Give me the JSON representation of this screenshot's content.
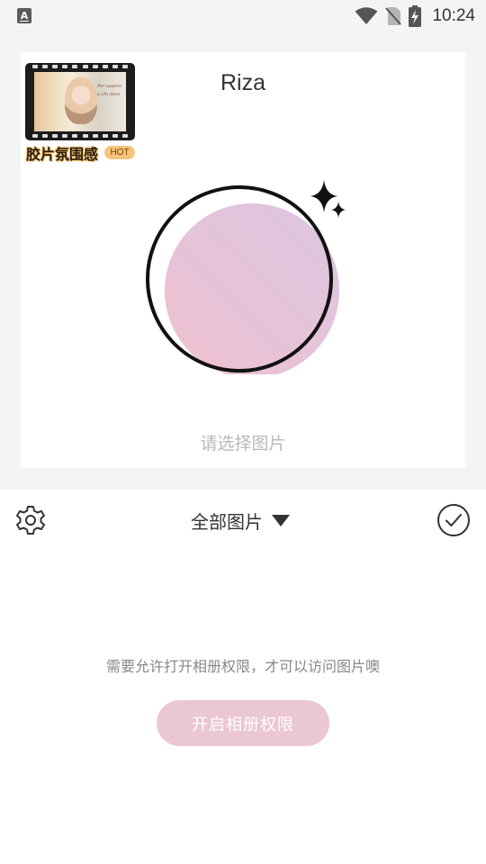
{
  "status_bar": {
    "app_icon_letter": "A",
    "time": "10:24",
    "icons": [
      "wifi-icon",
      "no-sim-icon",
      "battery-charging-icon"
    ]
  },
  "preview": {
    "sticker": {
      "caption": "胶片氛围感",
      "badge": "HOT",
      "photo_script": [
        "Per sapere",
        "a chi dare"
      ]
    },
    "name": "Riza",
    "frame_icon": "circle-frame-with-sparkle",
    "prompt": "请选择图片"
  },
  "toolbar": {
    "settings_icon": "gear-icon",
    "album_label": "全部图片",
    "dropdown_icon": "triangle-down-icon",
    "confirm_icon": "check-circle-icon"
  },
  "permission": {
    "message": "需要允许打开相册权限，才可以访问图片噢",
    "button_label": "开启相册权限"
  },
  "colors": {
    "accent_pink": "#ebc6d4",
    "background_gray": "#f4f4f4"
  }
}
